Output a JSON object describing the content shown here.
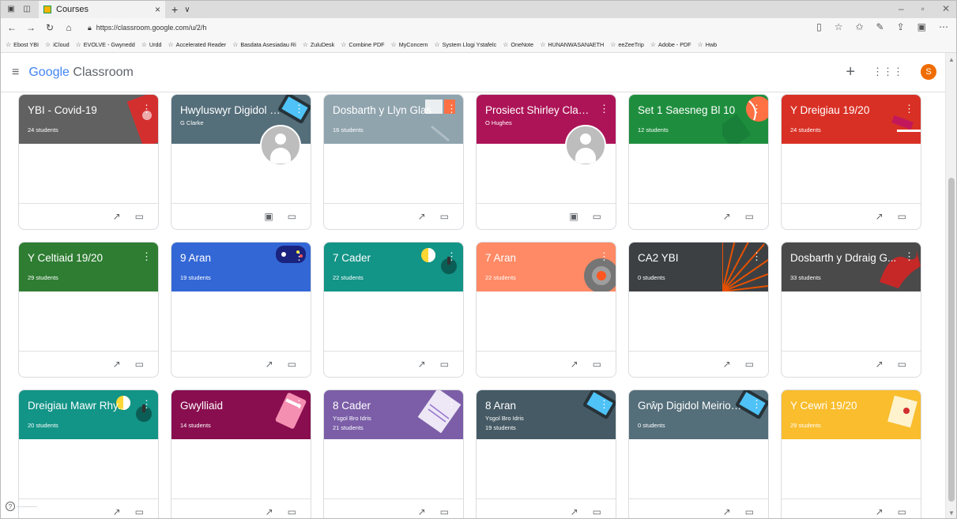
{
  "browser": {
    "tab_title": "Courses",
    "tab_close": "×",
    "new_tab": "+",
    "tab_list": "∨",
    "url": "https://classroom.google.com/u/2/h",
    "favorites": [
      "Ebost YBI",
      "iCloud",
      "EVOLVE - Gwynedd",
      "Urdd",
      "Accelerated Reader",
      "Basdata Asesiadau Ri",
      "ZuluDesk",
      "Combine PDF",
      "MyConcern",
      "System Llogi Ystafelc",
      "OneNote",
      "HUNANWASANAETH",
      "eeZeeTrip",
      "Adobe - PDF",
      "Hwb"
    ]
  },
  "app": {
    "logo_google": "Google",
    "logo_classroom": "Classroom",
    "avatar_letter": "S"
  },
  "courses": [
    {
      "title": "YBI - Covid-19",
      "subtitle": "",
      "students": "24 students",
      "color": "#616161",
      "deco": "red-shape",
      "footer": "trend"
    },
    {
      "title": "Hwyluswyr Digidol G...",
      "subtitle": "G Clarke",
      "students": "",
      "color": "#546e7a",
      "deco": "tablet",
      "footer": "assign",
      "owner_photo": true
    },
    {
      "title": "Dosbarth y Llyn Glas",
      "subtitle": "",
      "students": "16 students",
      "color": "#90a4ae",
      "deco": "book",
      "footer": "trend"
    },
    {
      "title": "Prosiect Shirley Clark...",
      "subtitle": "O Hughes",
      "students": "",
      "color": "#ad1457",
      "deco": "none",
      "footer": "assign",
      "owner_photo": true
    },
    {
      "title": "Set 1 Saesneg Bl 10",
      "subtitle": "",
      "students": "12 students",
      "color": "#1e8e3e",
      "deco": "ball",
      "footer": "trend"
    },
    {
      "title": "Y Dreigiau 19/20",
      "subtitle": "",
      "students": "24 students",
      "color": "#d93025",
      "deco": "table",
      "footer": "trend"
    },
    {
      "title": "Y Celtiaid 19/20",
      "subtitle": "",
      "students": "29 students",
      "color": "#2e7d32",
      "deco": "none",
      "footer": "trend"
    },
    {
      "title": "9 Aran",
      "subtitle": "",
      "students": "19 students",
      "color": "#3367d6",
      "deco": "gamepad",
      "footer": "trend"
    },
    {
      "title": "7 Cader",
      "subtitle": "",
      "students": "22 students",
      "color": "#129487",
      "deco": "yellow-dot",
      "footer": "trend"
    },
    {
      "title": "7 Aran",
      "subtitle": "",
      "students": "22 students",
      "color": "#ff8a65",
      "deco": "gear",
      "footer": "trend"
    },
    {
      "title": "CA2 YBI",
      "subtitle": "",
      "students": "0 students",
      "color": "#3c4043",
      "deco": "sunburst",
      "footer": "trend"
    },
    {
      "title": "Dosbarth y Ddraig G...",
      "subtitle": "",
      "students": "33 students",
      "color": "#4a4a4a",
      "deco": "dragon",
      "footer": "trend"
    },
    {
      "title": "Dreigiau Mawr Rhy...",
      "subtitle": "",
      "students": "20 students",
      "color": "#129487",
      "deco": "yellow-dot",
      "footer": "trend"
    },
    {
      "title": "Gwylliaid",
      "subtitle": "",
      "students": "14 students",
      "color": "#880e4f",
      "deco": "gift",
      "footer": "trend"
    },
    {
      "title": "8 Cader",
      "subtitle": "Ysgol Bro Idris",
      "students": "21 students",
      "color": "#7b5ea7",
      "deco": "paper",
      "footer": "trend"
    },
    {
      "title": "8 Aran",
      "subtitle": "Ysgol Bro Idris",
      "students": "19 students",
      "color": "#455a64",
      "deco": "tablet",
      "footer": "trend"
    },
    {
      "title": "Grŵp Digidol Meirion...",
      "subtitle": "",
      "students": "0 students",
      "color": "#546e7a",
      "deco": "tablet",
      "footer": "trend"
    },
    {
      "title": "Y Cewri 19/20",
      "subtitle": "",
      "students": "29 students",
      "color": "#f9bd2d",
      "deco": "flag",
      "footer": "trend"
    }
  ]
}
